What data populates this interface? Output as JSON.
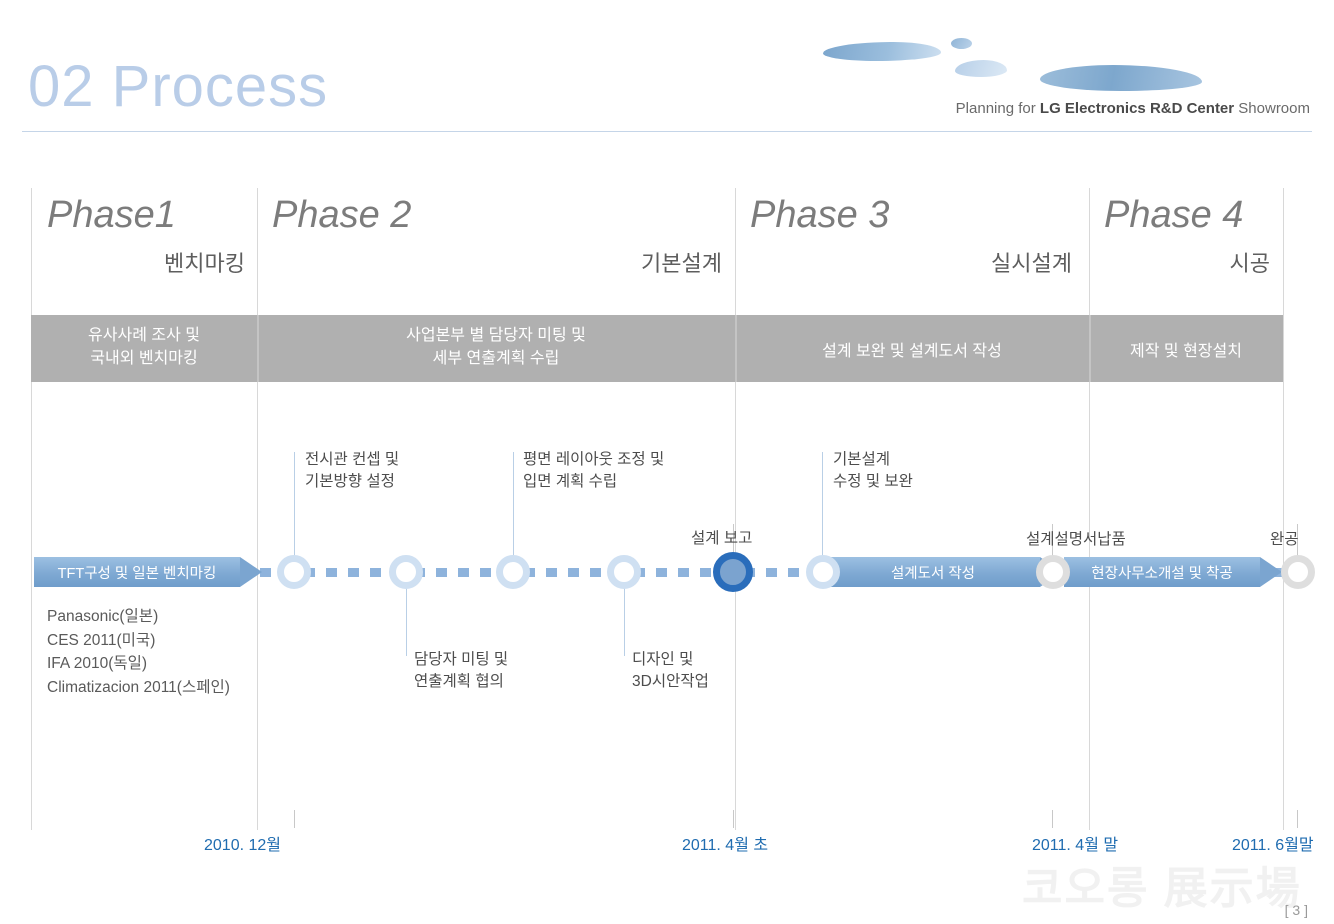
{
  "header": {
    "slide_number": "02",
    "title": "02 Process",
    "subtitle_prefix": "Planning for ",
    "subtitle_strong": "LG Electronics R&D Center",
    "subtitle_suffix": " Showroom",
    "accent_color": "#b9cde8",
    "rule_color": "#c5d5e8"
  },
  "phases": [
    {
      "name": "Phase1",
      "sub": "벤치마킹",
      "band": "유사사례 조사 및\n국내외 벤치마킹"
    },
    {
      "name": "Phase 2",
      "sub": "기본설계",
      "band": "사업본부 별 담당자 미팅 및\n세부 연출계획 수립"
    },
    {
      "name": "Phase 3",
      "sub": "실시설계",
      "band": "설계 보완 및 설계도서 작성"
    },
    {
      "name": "Phase 4",
      "sub": "시공",
      "band": "제작 및 현장설치"
    }
  ],
  "band_color": "#b0b0b0",
  "timeline": {
    "bars": [
      {
        "label": "TFT구성 및 일본 벤치마킹"
      },
      {
        "label": "설계도서 작성"
      },
      {
        "label": "현장사무소개설 및 착공"
      }
    ],
    "callouts_above": [
      "전시관 컨셉 및\n기본방향 설정",
      "평면 레이아웃 조정 및\n입면 계획 수립",
      "기본설계\n수정 및 보완"
    ],
    "callouts_below": [
      "담당자 미팅 및\n연출계획 협의",
      "디자인 및\n3D시안작업"
    ],
    "node_labels": [
      "설계 보고",
      "설계설명서납품",
      "완공"
    ],
    "benchmark_list": "Panasonic(일본)\nCES 2011(미국)\nIFA 2010(독일)\nClimatizacion 2011(스페인)",
    "node_fill_color": "#2a6dbb",
    "node_ring_color": "#cfe0f2",
    "dot_color": "#8eb3dc"
  },
  "dates": [
    {
      "label": "2010. 12월"
    },
    {
      "label": "2011. 4월 초"
    },
    {
      "label": "2011. 4월 말"
    },
    {
      "label": "2011. 6월말"
    }
  ],
  "date_color": "#1f6cb0",
  "footer": {
    "watermark": "코오롱 展示場",
    "page": "[ 3 ]"
  }
}
